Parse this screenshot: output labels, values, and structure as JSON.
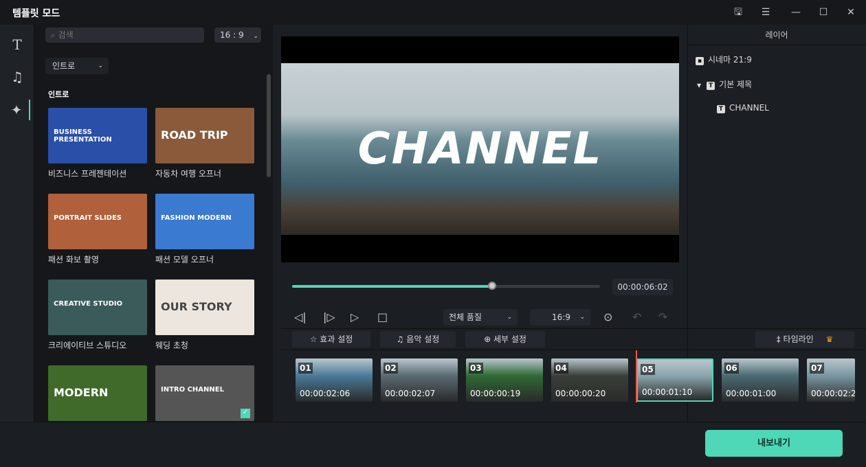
{
  "window": {
    "title": "템플릿 모드"
  },
  "sidebar": {
    "search_placeholder": "검색",
    "ratio": "16 : 9",
    "category": "인트로",
    "section_label": "인트로",
    "templates": [
      {
        "label": "비즈니스 프레젠테이션",
        "thumb_text": "BUSINESS PRESENTATION",
        "bg": "#2a4fa8"
      },
      {
        "label": "자동차 여행 오프너",
        "thumb_text": "ROAD TRIP",
        "bg": "#8a5a3a"
      },
      {
        "label": "패션 화보 촬영",
        "thumb_text": "PORTRAIT SLIDES",
        "bg": "#b0603a"
      },
      {
        "label": "패션 모델 오프너",
        "thumb_text": "FASHION MODERN",
        "bg": "#3a7ad0"
      },
      {
        "label": "크리에이티브 스튜디오",
        "thumb_text": "CREATIVE STUDIO",
        "bg": "#3b5a5a"
      },
      {
        "label": "웨딩 초청",
        "thumb_text": "OUR STORY",
        "bg": "#ece6de"
      },
      {
        "label": "",
        "thumb_text": "MODERN",
        "bg": "#3f6a2a"
      },
      {
        "label": "",
        "thumb_text": "INTRO CHANNEL",
        "bg": "#555555"
      }
    ]
  },
  "preview": {
    "overlay_text": "CHANNEL",
    "timecode": "00:00:06:02",
    "progress": 0.65,
    "quality": "전체 품질",
    "aspect": "16:9"
  },
  "layers": {
    "header": "레이어",
    "items": [
      "시네마 21:9",
      "기본 제목",
      "CHANNEL"
    ]
  },
  "tabs": {
    "effects": "효과 설정",
    "music": "음악 설정",
    "detail": "세부 설정",
    "timeline": "타임라인"
  },
  "clips": [
    {
      "num": "01",
      "duration": "00:00:02:06",
      "bg": "#4a7a98"
    },
    {
      "num": "02",
      "duration": "00:00:02:07",
      "bg": "#5a6a72"
    },
    {
      "num": "03",
      "duration": "00:00:00:19",
      "bg": "#2f6a34"
    },
    {
      "num": "04",
      "duration": "00:00:00:20",
      "bg": "#3a3f3a"
    },
    {
      "num": "05",
      "duration": "00:00:01:10",
      "bg": "#8aa4ac"
    },
    {
      "num": "06",
      "duration": "00:00:01:00",
      "bg": "#4a6a72"
    },
    {
      "num": "07",
      "duration": "00:00:02:2",
      "bg": "#7a96a0"
    }
  ],
  "footer": {
    "export": "내보내기"
  },
  "colors": {
    "accent": "#4ed8b7",
    "playhead": "#e85a4f"
  }
}
